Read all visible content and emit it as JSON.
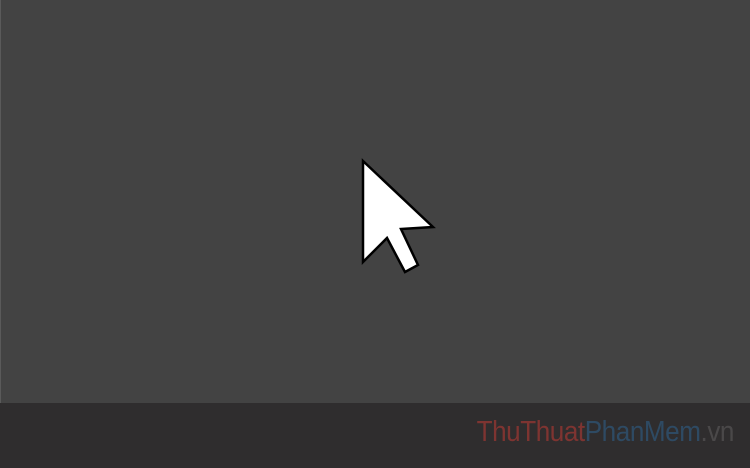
{
  "colors": {
    "canvas_background": "#434343",
    "taskbar_background": "#2f2d2e",
    "cursor_fill": "#ffffff",
    "cursor_outline": "#000000"
  },
  "cursor": {
    "icon": "mouse-pointer-arrow-icon"
  },
  "watermark": {
    "part1": "ThuThuat",
    "part2": "PhanMem",
    "part3": ".vn"
  }
}
